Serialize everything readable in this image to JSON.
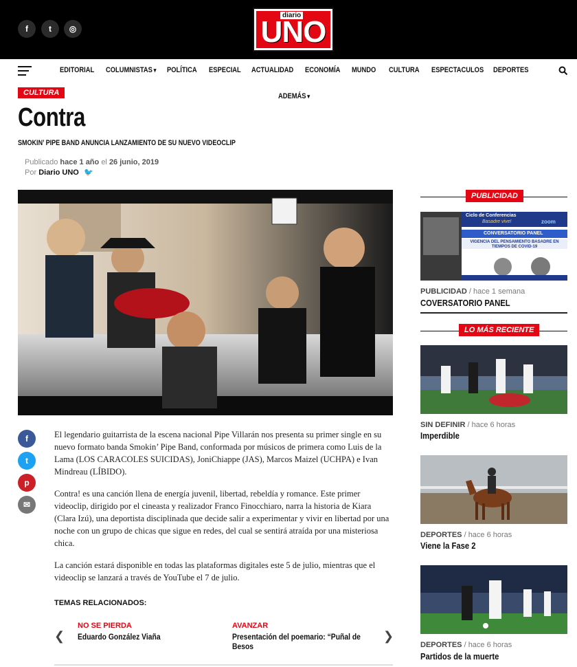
{
  "header": {
    "social": [
      {
        "name": "facebook-icon",
        "glyph": "f"
      },
      {
        "name": "twitter-icon",
        "glyph": "t"
      },
      {
        "name": "instagram-icon",
        "glyph": "◎"
      }
    ],
    "logo": {
      "small": "diario",
      "big": "UNO"
    }
  },
  "nav": {
    "items": [
      "EDITORIAL",
      "COLUMNISTAS",
      "POLÍTICA",
      "ESPECIAL",
      "ACTUALIDAD",
      "ECONOMÍA",
      "MUNDO",
      "CULTURA",
      "ESPECTACULOS",
      "DEPORTES"
    ],
    "more": "ADEMÁS"
  },
  "article": {
    "category": "CULTURA",
    "title": "Contra",
    "subtitle": "SMOKIN’ PIPE BAND ANUNCIA LANZAMIENTO DE SU NUEVO VIDEOCLIP",
    "published_prefix": "Publicado",
    "published_relative": "hace 1 año",
    "published_mid": "el",
    "published_date": "26 junio, 2019",
    "by_prefix": "Por",
    "author": "Diario UNO",
    "paragraphs": [
      "El legendario guitarrista de la escena nacional Pipe Villarán nos presenta su primer single en su nuevo formato banda Smokin’ Pipe Band, conformada por músicos de primera como Luis de la Lama (LOS CARACOLES SUICIDAS), JoniChiappe (JAS), Marcos Maizel (UCHPA) e Ivan Mindreau (LÍBIDO).",
      "Contra! es una canción llena de energía juvenil, libertad, rebeldía y romance. Este primer videoclip, dirigido por el cineasta y realizador Franco Finocchiaro, narra la historia de Kiara (Clara Izú), una deportista disciplinada que decide salir a experimentar y vivir en libertad por una noche con un grupo de chicas que sigue en redes, del cual se sentirá atraída por una misteriosa chica.",
      "La canción estará disponible en todas las plataformas digitales este 5 de julio, mientras que el videoclip se lanzará a través de YouTube el 7 de julio."
    ],
    "related_label": "TEMAS RELACIONADOS:",
    "prev": {
      "label": "NO SE PIERDA",
      "title": "Eduardo González Viaña"
    },
    "next": {
      "label": "AVANZAR",
      "title": "Presentación del poemario: “Puñal de Besos"
    }
  },
  "share": [
    {
      "name": "share-facebook-icon",
      "glyph": "f",
      "color": "#3b5998"
    },
    {
      "name": "share-twitter-icon",
      "glyph": "t",
      "color": "#1da1f2"
    },
    {
      "name": "share-pinterest-icon",
      "glyph": "p",
      "color": "#cb2027"
    },
    {
      "name": "share-email-icon",
      "glyph": "✉",
      "color": "#777777"
    }
  ],
  "sidebar": {
    "ad_heading": "PUBLICIDAD",
    "ad_banner": {
      "line1": "Ciclo de Conferencias",
      "line2": "Basadre vive!",
      "line3": "CONVERSATORIO PANEL",
      "line4": "VIGENCIA DEL PENSAMIENTO BASADRE EN TIEMPOS DE COVID-19",
      "brand": "zoom"
    },
    "ad_card": {
      "category": "PUBLICIDAD",
      "time": "hace 1 semana",
      "title": "COVERSATORIO PANEL"
    },
    "recent_heading": "LO MÁS RECIENTE",
    "recent": [
      {
        "category": "SIN DEFINIR",
        "time": "hace 6 horas",
        "title": "Imperdible"
      },
      {
        "category": "DEPORTES",
        "time": "hace 6 horas",
        "title": "Viene la Fase 2"
      },
      {
        "category": "DEPORTES",
        "time": "hace 6 horas",
        "title": "Partidos de la muerte"
      }
    ]
  },
  "colors": {
    "accent": "#e30613",
    "topbar": "#000000"
  }
}
